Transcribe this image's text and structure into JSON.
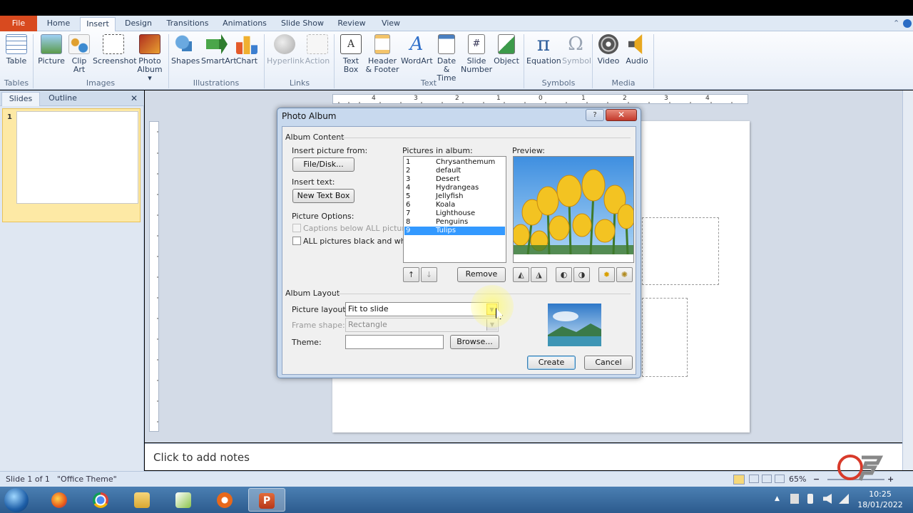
{
  "ribbon_tabs": [
    "File",
    "Home",
    "Insert",
    "Design",
    "Transitions",
    "Animations",
    "Slide Show",
    "Review",
    "View"
  ],
  "ribbon": {
    "tables": {
      "label": "Tables",
      "table": "Table"
    },
    "images": {
      "label": "Images",
      "picture": "Picture",
      "clip_art_1": "Clip",
      "clip_art_2": "Art",
      "screenshot": "Screenshot",
      "photo_album_1": "Photo",
      "photo_album_2": "Album ▾"
    },
    "illustrations": {
      "label": "Illustrations",
      "shapes": "Shapes",
      "smartart": "SmartArt",
      "chart": "Chart"
    },
    "links": {
      "label": "Links",
      "hyperlink": "Hyperlink",
      "action": "Action"
    },
    "text": {
      "label": "Text",
      "textbox_1": "Text",
      "textbox_2": "Box",
      "header_1": "Header",
      "header_2": "& Footer",
      "wordart": "WordArt",
      "datetime_1": "Date",
      "datetime_2": "& Time",
      "slidenum_1": "Slide",
      "slidenum_2": "Number",
      "object": "Object"
    },
    "symbols": {
      "label": "Symbols",
      "equation": "Equation",
      "symbol": "Symbol"
    },
    "media": {
      "label": "Media",
      "video": "Video",
      "audio": "Audio"
    }
  },
  "pane": {
    "tab_slides": "Slides",
    "tab_outline": "Outline",
    "close": "✕",
    "thumb_number": "1"
  },
  "ruler_marks": [
    "4",
    "3",
    "2",
    "1",
    "0",
    "1",
    "2",
    "3",
    "4"
  ],
  "notes_placeholder": "Click to add notes",
  "status": {
    "slide": "Slide 1 of 1",
    "theme": "\"Office Theme\"",
    "zoom": "65%"
  },
  "taskbar": {
    "time": "10:25",
    "date": "18/01/2022"
  },
  "dialog": {
    "title": "Photo Album",
    "help": "?",
    "close": "✕",
    "album_content": "Album Content",
    "insert_picture_from": "Insert picture from:",
    "file_disk": "File/Disk...",
    "insert_text": "Insert text:",
    "new_text_box": "New Text Box",
    "picture_options": "Picture Options:",
    "captions_below": "Captions below ALL pictures",
    "all_bw": "ALL pictures black and white",
    "pictures_in_album": "Pictures in album:",
    "pictures": [
      {
        "n": "1",
        "name": "Chrysanthemum"
      },
      {
        "n": "2",
        "name": "default"
      },
      {
        "n": "3",
        "name": "Desert"
      },
      {
        "n": "4",
        "name": "Hydrangeas"
      },
      {
        "n": "5",
        "name": "Jellyfish"
      },
      {
        "n": "6",
        "name": "Koala"
      },
      {
        "n": "7",
        "name": "Lighthouse"
      },
      {
        "n": "8",
        "name": "Penguins"
      },
      {
        "n": "9",
        "name": "Tulips"
      }
    ],
    "selected_index": 8,
    "preview": "Preview:",
    "remove": "Remove",
    "move_up": "↑",
    "move_down": "↓",
    "album_layout": "Album Layout",
    "picture_layout_label": "Picture layout:",
    "picture_layout_value": "Fit to slide",
    "frame_shape_label": "Frame shape:",
    "frame_shape_value": "Rectangle",
    "theme_label": "Theme:",
    "theme_value": "",
    "browse": "Browse...",
    "create": "Create",
    "cancel": "Cancel"
  },
  "colors": {
    "file_tab": "#d84a1f",
    "selection": "#3399ff",
    "ribbon_bg": "#e7eef8",
    "thumb_highlight": "#fde9a5"
  }
}
